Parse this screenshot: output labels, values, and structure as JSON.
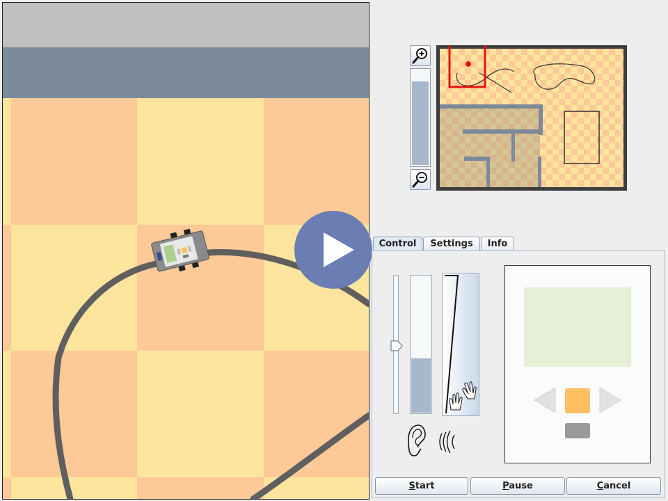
{
  "tabs": [
    {
      "label": "Control",
      "active": true
    },
    {
      "label": "Settings",
      "active": false
    },
    {
      "label": "Info",
      "active": false
    }
  ],
  "buttons": {
    "start_label": "Start",
    "pause_label": "Pause",
    "cancel_label": "Cancel"
  },
  "zoom": {
    "level_fraction": 0.88
  },
  "motor_slider": {
    "value_fraction": 0.38
  },
  "level_meter": {
    "value_fraction": 0.4
  },
  "icons": {
    "zoom_in": "zoom-in-magnifier-icon",
    "zoom_out": "zoom-out-magnifier-icon",
    "ear": "ear-icon",
    "sound": "sound-waves-icon",
    "touch": "hand-touch-icon",
    "play": "play-icon",
    "left": "left-arrow-icon",
    "right": "right-arrow-icon"
  },
  "colors": {
    "tile_orange": "#fcc997",
    "tile_yellow": "#fde59e",
    "track": "#5f5f5f",
    "wall_top": "#c0c0c0",
    "wall_blue": "#7b8a9a",
    "play_accent": "#6a7eb4",
    "robot_center_button": "#ffbf63",
    "robot_lcd": "#e5f0d6",
    "minimap_path": "#e8120f"
  }
}
